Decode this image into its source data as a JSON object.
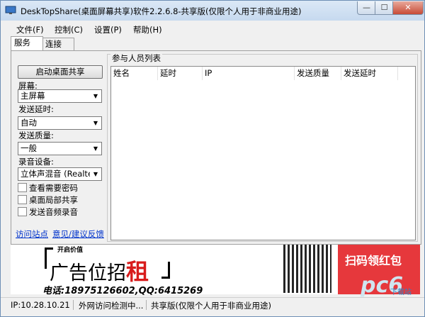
{
  "window": {
    "title": "DeskTopShare(桌面屏幕共享)软件2.2.6.8-共享版(仅限个人用于非商业用途)",
    "minimize": "—",
    "maximize": "☐",
    "close": "✕"
  },
  "menu": [
    "文件(F)",
    "控制(C)",
    "设置(P)",
    "帮助(H)"
  ],
  "tabs": [
    "服务",
    "连接"
  ],
  "left": {
    "start_button": "启动桌面共享",
    "screen_label": "屏幕:",
    "screen_value": "主屏幕",
    "delay_label": "发送延时:",
    "delay_value": "自动",
    "quality_label": "发送质量:",
    "quality_value": "一般",
    "audio_label": "录音设备:",
    "audio_value": "立体声混音 (Realte",
    "checks": [
      "查看需要密码",
      "桌面局部共享",
      "发送音频录音"
    ],
    "link_site": "访问站点",
    "link_feedback": "意见/建议反馈"
  },
  "list": {
    "title": "参与人员列表",
    "columns": [
      "姓名",
      "延时",
      "IP",
      "发送质量",
      "发送延时"
    ]
  },
  "ad": {
    "top": "开启价值",
    "big": "广告位招",
    "rent": "租",
    "phone": "电话:18975126602,QQ:6415269",
    "red_text": "扫码领红包",
    "watermark": "pc6",
    "watermark_sub": "下载站"
  },
  "status": {
    "ip": "IP:10.28.10.21",
    "check": "外网访问检测中...",
    "edition": "共享版(仅限个人用于非商业用途)"
  }
}
